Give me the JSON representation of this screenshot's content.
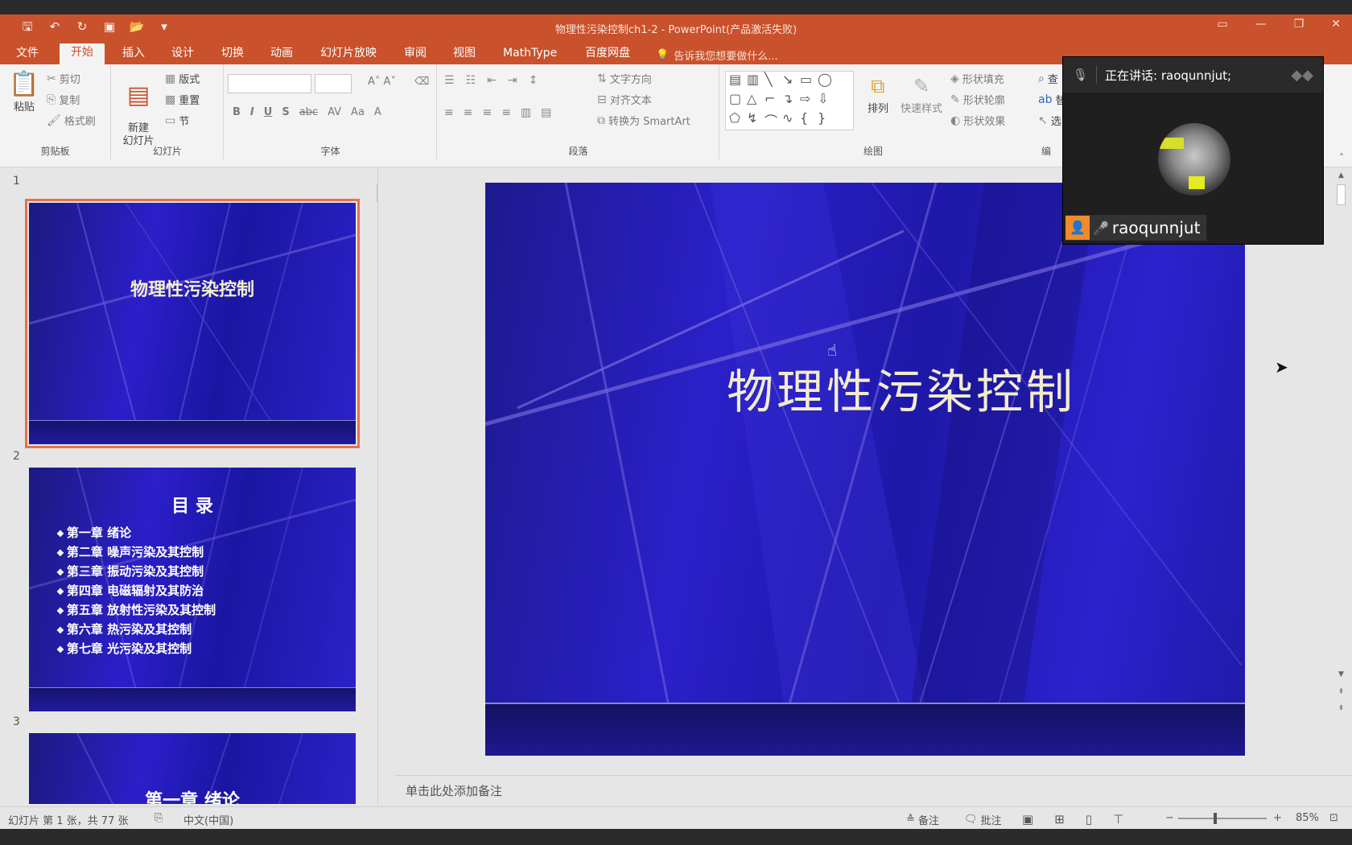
{
  "window": {
    "title": "物理性污染控制ch1-2 - PowerPoint(产品激活失败)"
  },
  "ribbon_tabs": [
    "文件",
    "开始",
    "插入",
    "设计",
    "切换",
    "动画",
    "幻灯片放映",
    "审阅",
    "视图",
    "MathType",
    "百度网盘"
  ],
  "tell_me": "告诉我您想要做什么...",
  "clipboard": {
    "paste": "粘贴",
    "cut": "剪切",
    "copy": "复制",
    "format_painter": "格式刷",
    "label": "剪贴板"
  },
  "slides_group": {
    "new_slide": "新建\n幻灯片",
    "layout": "版式",
    "reset": "重置",
    "section": "节",
    "label": "幻灯片"
  },
  "font_group": {
    "label": "字体"
  },
  "paragraph_group": {
    "text_direction": "文字方向",
    "align_text": "对齐文本",
    "smartart": "转换为 SmartArt",
    "label": "段落"
  },
  "drawing_group": {
    "arrange": "排列",
    "quick_styles": "快速样式",
    "shape_fill": "形状填充",
    "shape_outline": "形状轮廓",
    "shape_effects": "形状效果",
    "label": "绘图"
  },
  "editing_group": {
    "find": "查",
    "replace": "替",
    "select": "选",
    "label": "编"
  },
  "thumbnails": [
    {
      "number": "1",
      "title": "物理性污染控制"
    },
    {
      "number": "2",
      "title": "目  录",
      "items": [
        "第一章  绪论",
        "第二章  噪声污染及其控制",
        "第三章  振动污染及其控制",
        "第四章  电磁辐射及其防治",
        "第五章  放射性污染及其控制",
        "第六章  热污染及其控制",
        "第七章  光污染及其控制"
      ]
    },
    {
      "number": "3",
      "title": "第一章  绪论"
    }
  ],
  "main_slide": {
    "title": "物理性污染控制"
  },
  "notes_placeholder": "单击此处添加备注",
  "meeting": {
    "speaking_label": "正在讲话: raoqunnjut;",
    "participant_name": "raoqunnjut"
  },
  "status_bar": {
    "slide_info": "幻灯片 第 1 张，共 77 张",
    "language": "中文(中国)",
    "notes": "备注",
    "comments": "批注",
    "zoom": "85%"
  }
}
